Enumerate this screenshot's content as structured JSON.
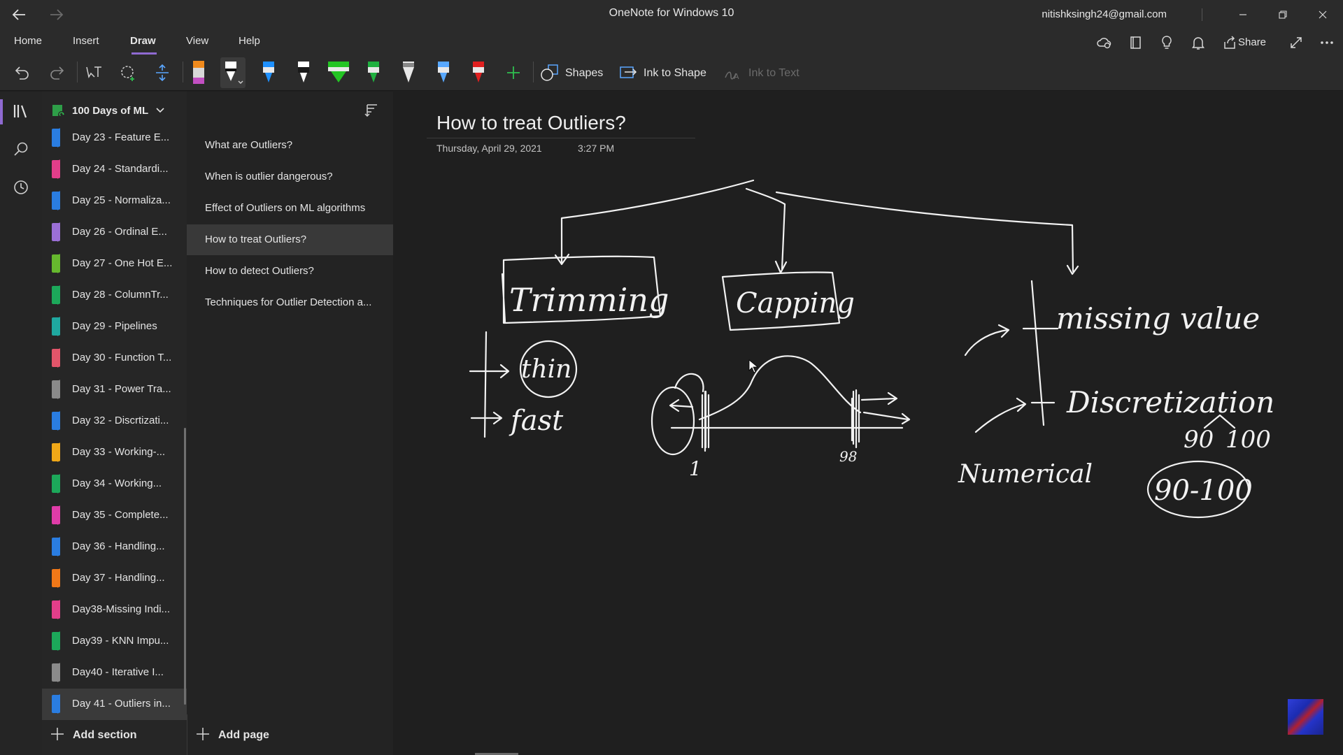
{
  "window": {
    "title": "OneNote for Windows 10",
    "account": "nitishksingh24@gmail.com"
  },
  "menu": {
    "tabs": [
      "Home",
      "Insert",
      "Draw",
      "View",
      "Help"
    ],
    "active_tab": "Draw",
    "share_label": "Share"
  },
  "toolbar": {
    "shapes_label": "Shapes",
    "ink_to_shape_label": "Ink to Shape",
    "ink_to_text_label": "Ink to Text",
    "pen_colors": [
      "#f08a1c",
      "#ffffff",
      "#1e90ff",
      "#ffffff",
      "#23c423",
      "#20b040",
      "#bbbbbb",
      "#58a8ff",
      "#e02020"
    ],
    "add_pen_color": "#2fbf4f",
    "accent": "#8f6ad1"
  },
  "notebook": {
    "name": "100 Days of ML",
    "icon_color": "#2e9e48"
  },
  "sections": [
    {
      "label": "Day 23 - Feature E...",
      "color": "#2a7de1"
    },
    {
      "label": "Day 24 - Standardi...",
      "color": "#e23e8a"
    },
    {
      "label": "Day 25 - Normaliza...",
      "color": "#2a7de1"
    },
    {
      "label": "Day 26 - Ordinal E...",
      "color": "#9b6fd6"
    },
    {
      "label": "Day 27 - One Hot E...",
      "color": "#66b82e"
    },
    {
      "label": "Day 28 - ColumnTr...",
      "color": "#1ca85a"
    },
    {
      "label": "Day 29 - Pipelines",
      "color": "#1fa8a0"
    },
    {
      "label": "Day 30 - Function T...",
      "color": "#e2556a"
    },
    {
      "label": "Day 31 - Power Tra...",
      "color": "#8a8a8a"
    },
    {
      "label": "Day 32 - Discrtizati...",
      "color": "#2a7de1"
    },
    {
      "label": "Day 33 - Working-...",
      "color": "#f0a818"
    },
    {
      "label": "Day 34 - Working...",
      "color": "#1ca85a"
    },
    {
      "label": "Day 35 - Complete...",
      "color": "#e03ca8"
    },
    {
      "label": "Day 36 - Handling...",
      "color": "#2a7de1"
    },
    {
      "label": "Day 37 - Handling...",
      "color": "#f07818"
    },
    {
      "label": "Day38-Missing Indi...",
      "color": "#e23e8a"
    },
    {
      "label": "Day39 - KNN Impu...",
      "color": "#1ca85a"
    },
    {
      "label": "Day40 - Iterative I...",
      "color": "#8a8a8a"
    },
    {
      "label": "Day 41 - Outliers in...",
      "color": "#2a7de1"
    }
  ],
  "active_section_index": 18,
  "pages": [
    {
      "label": "What are Outliers?"
    },
    {
      "label": "When is outlier dangerous?"
    },
    {
      "label": "Effect of Outliers on ML algorithms"
    },
    {
      "label": "How to treat Outliers?"
    },
    {
      "label": "How to detect Outliers?"
    },
    {
      "label": "Techniques for Outlier Detection a..."
    }
  ],
  "active_page_index": 3,
  "add_section_label": "Add section",
  "add_page_label": "Add page",
  "page": {
    "title": "How to treat Outliers?",
    "date": "Thursday, April 29, 2021",
    "time": "3:27 PM"
  },
  "ink": {
    "trimming": "Trimming",
    "capping": "Capping",
    "thin": "thin",
    "fast": "fast",
    "missing_value": "missing value",
    "discretization": "Discretization",
    "numerical": "Numerical",
    "label_1": "1",
    "label_98": "98",
    "label_90": "90",
    "label_100": "100",
    "range": "90-100"
  }
}
